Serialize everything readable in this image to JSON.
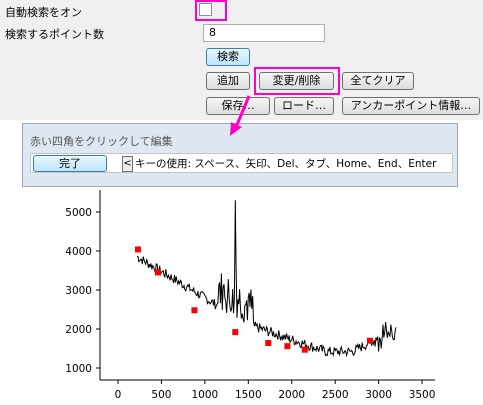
{
  "panel": {
    "auto_search_label": "自動検索をオン",
    "points_label": "検索するポイント数",
    "points_value": "8",
    "search_button": "検索",
    "add_button": "追加",
    "modify_delete_button": "変更/削除",
    "clear_all_button": "全てクリア",
    "save_button": "保存…",
    "load_button": "ロード…",
    "anchor_info_button": "アンカーポイント情報…"
  },
  "tooltip": {
    "title": "赤い四角をクリックして編集",
    "done_button": "完了",
    "arrow_glyph": "<",
    "keys_hint": "キーの使用: スペース、矢印、Del、タブ、Home、End、Enter"
  },
  "colors": {
    "highlight": "#ff00c8",
    "anchor_point": "#ff0000",
    "curve": "#000000"
  },
  "chart_data": {
    "type": "line",
    "x_ticks": [
      "0",
      "500",
      "1000",
      "1500",
      "2000",
      "2500",
      "3000",
      "3500"
    ],
    "y_ticks": [
      "1000",
      "2000",
      "3000",
      "4000",
      "5000"
    ],
    "xlim": [
      0,
      3500
    ],
    "ylim": [
      700,
      5300
    ],
    "anchor_points": [
      {
        "x": 230,
        "y": 4040
      },
      {
        "x": 460,
        "y": 3450
      },
      {
        "x": 880,
        "y": 2480
      },
      {
        "x": 1350,
        "y": 1920
      },
      {
        "x": 1730,
        "y": 1640
      },
      {
        "x": 1950,
        "y": 1560
      },
      {
        "x": 2150,
        "y": 1470
      },
      {
        "x": 2900,
        "y": 1700
      }
    ]
  }
}
